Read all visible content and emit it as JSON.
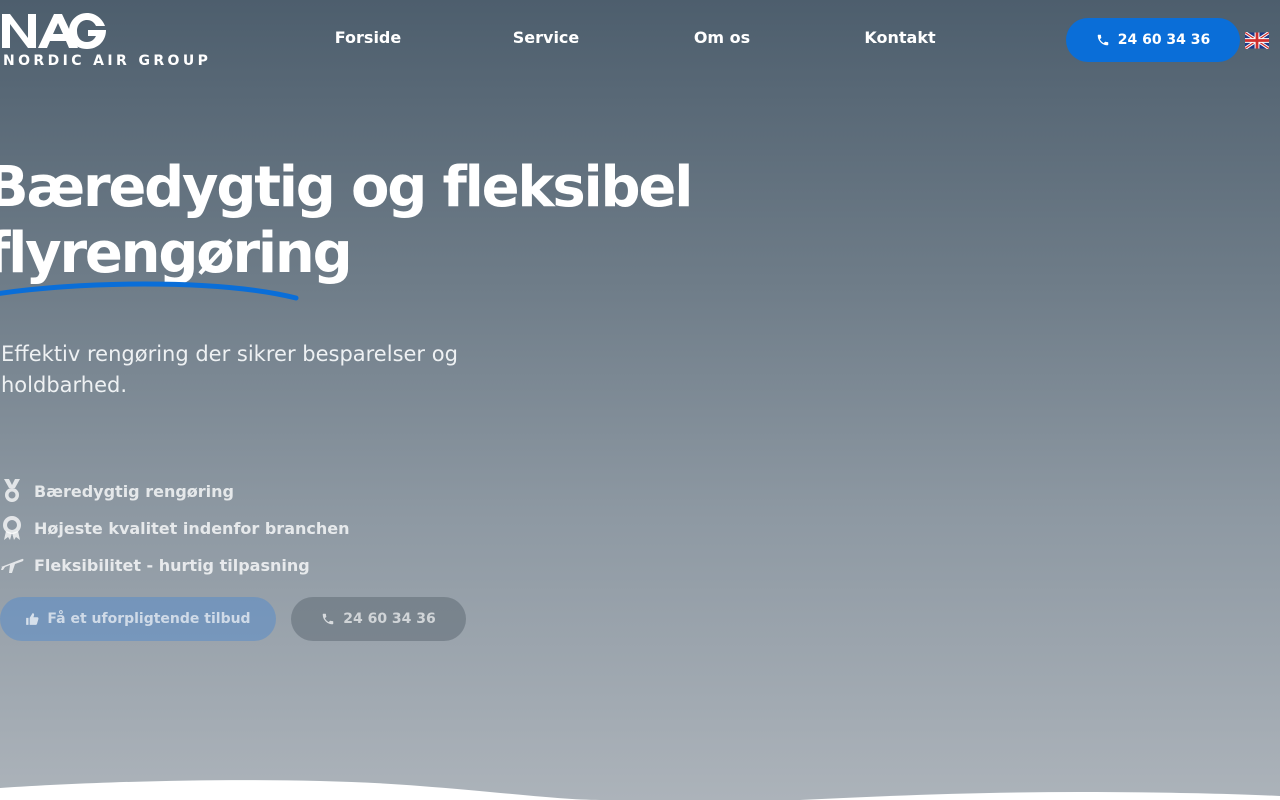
{
  "brand": {
    "logo_text": "NAG",
    "name": "NORDIC AIR GROUP"
  },
  "nav": {
    "items": [
      {
        "label": "Forside"
      },
      {
        "label": "Service"
      },
      {
        "label": "Om os"
      },
      {
        "label": "Kontakt"
      }
    ]
  },
  "header_cta": {
    "phone": "24 60 34 36",
    "icon": "phone-icon"
  },
  "language": {
    "icon": "uk-flag-icon"
  },
  "hero": {
    "title_line1": "Bæredygtig og fleksibel",
    "title_line2": "flyrengøring",
    "subtitle": "Effektiv rengøring der sikrer besparelser og holdbarhed."
  },
  "features": [
    {
      "icon": "medal-icon",
      "label": "Bæredygtig rengøring"
    },
    {
      "icon": "award-icon",
      "label": "Højeste kvalitet indenfor branchen"
    },
    {
      "icon": "plane-icon",
      "label": "Fleksibilitet - hurtig tilpasning"
    }
  ],
  "buttons": {
    "offer_label": "Få et uforpligtende tilbud",
    "offer_icon": "thumbs-up-icon",
    "phone_label": "24 60 34 36",
    "phone_icon": "phone-icon"
  },
  "colors": {
    "accent": "#0a6ed8",
    "text": "#ffffff"
  }
}
